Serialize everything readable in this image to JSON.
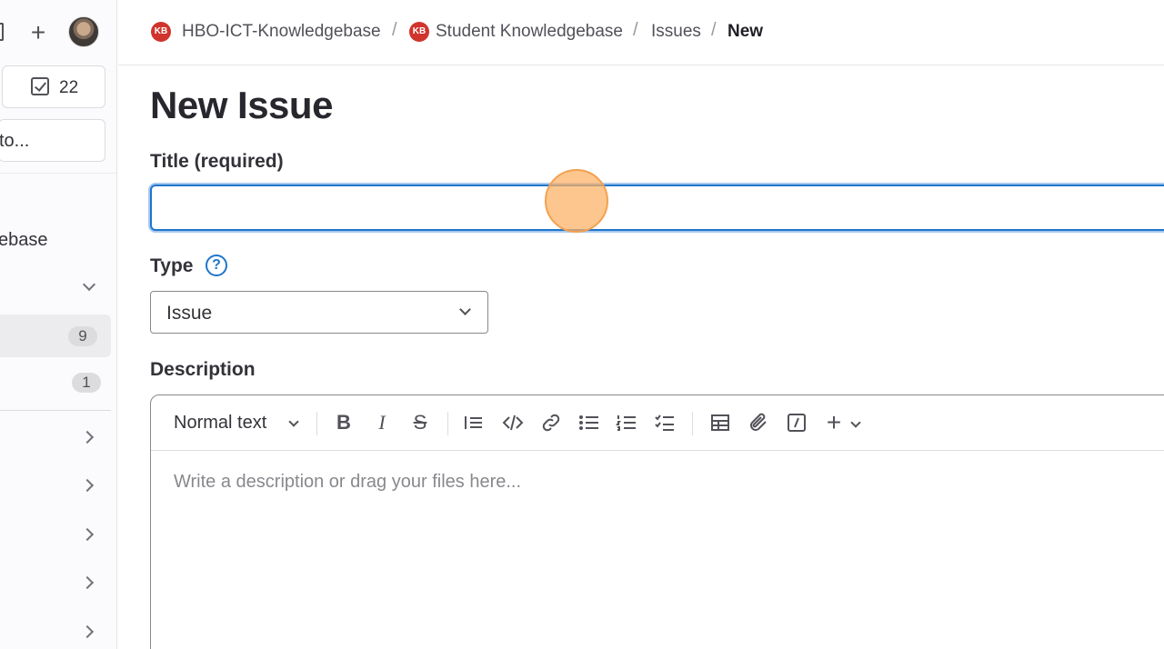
{
  "sidebar": {
    "todo_count": "22",
    "search_text": "to...",
    "project_name_partial": "ebase",
    "badges": {
      "issues_count": "9",
      "merge_requests_count": "1"
    }
  },
  "breadcrumb": {
    "group": "HBO-ICT-Knowledgebase",
    "project": "Student Knowledgebase",
    "section": "Issues",
    "current": "New",
    "logo_text": "KB",
    "separator": "/"
  },
  "form": {
    "page_title": "New Issue",
    "title_label": "Title (required)",
    "title_value": "",
    "type_label": "Type",
    "type_help_glyph": "?",
    "type_value": "Issue",
    "description_label": "Description",
    "description_placeholder": "Write a description or drag your files here...",
    "text_style": "Normal text"
  },
  "icons": {
    "plus": "+",
    "bold": "B",
    "italic": "I",
    "strikethrough": "S",
    "slash": "/"
  },
  "colors": {
    "accent": "#1f75cb",
    "logo": "#d0342c",
    "click_marker": "#fbb063"
  }
}
